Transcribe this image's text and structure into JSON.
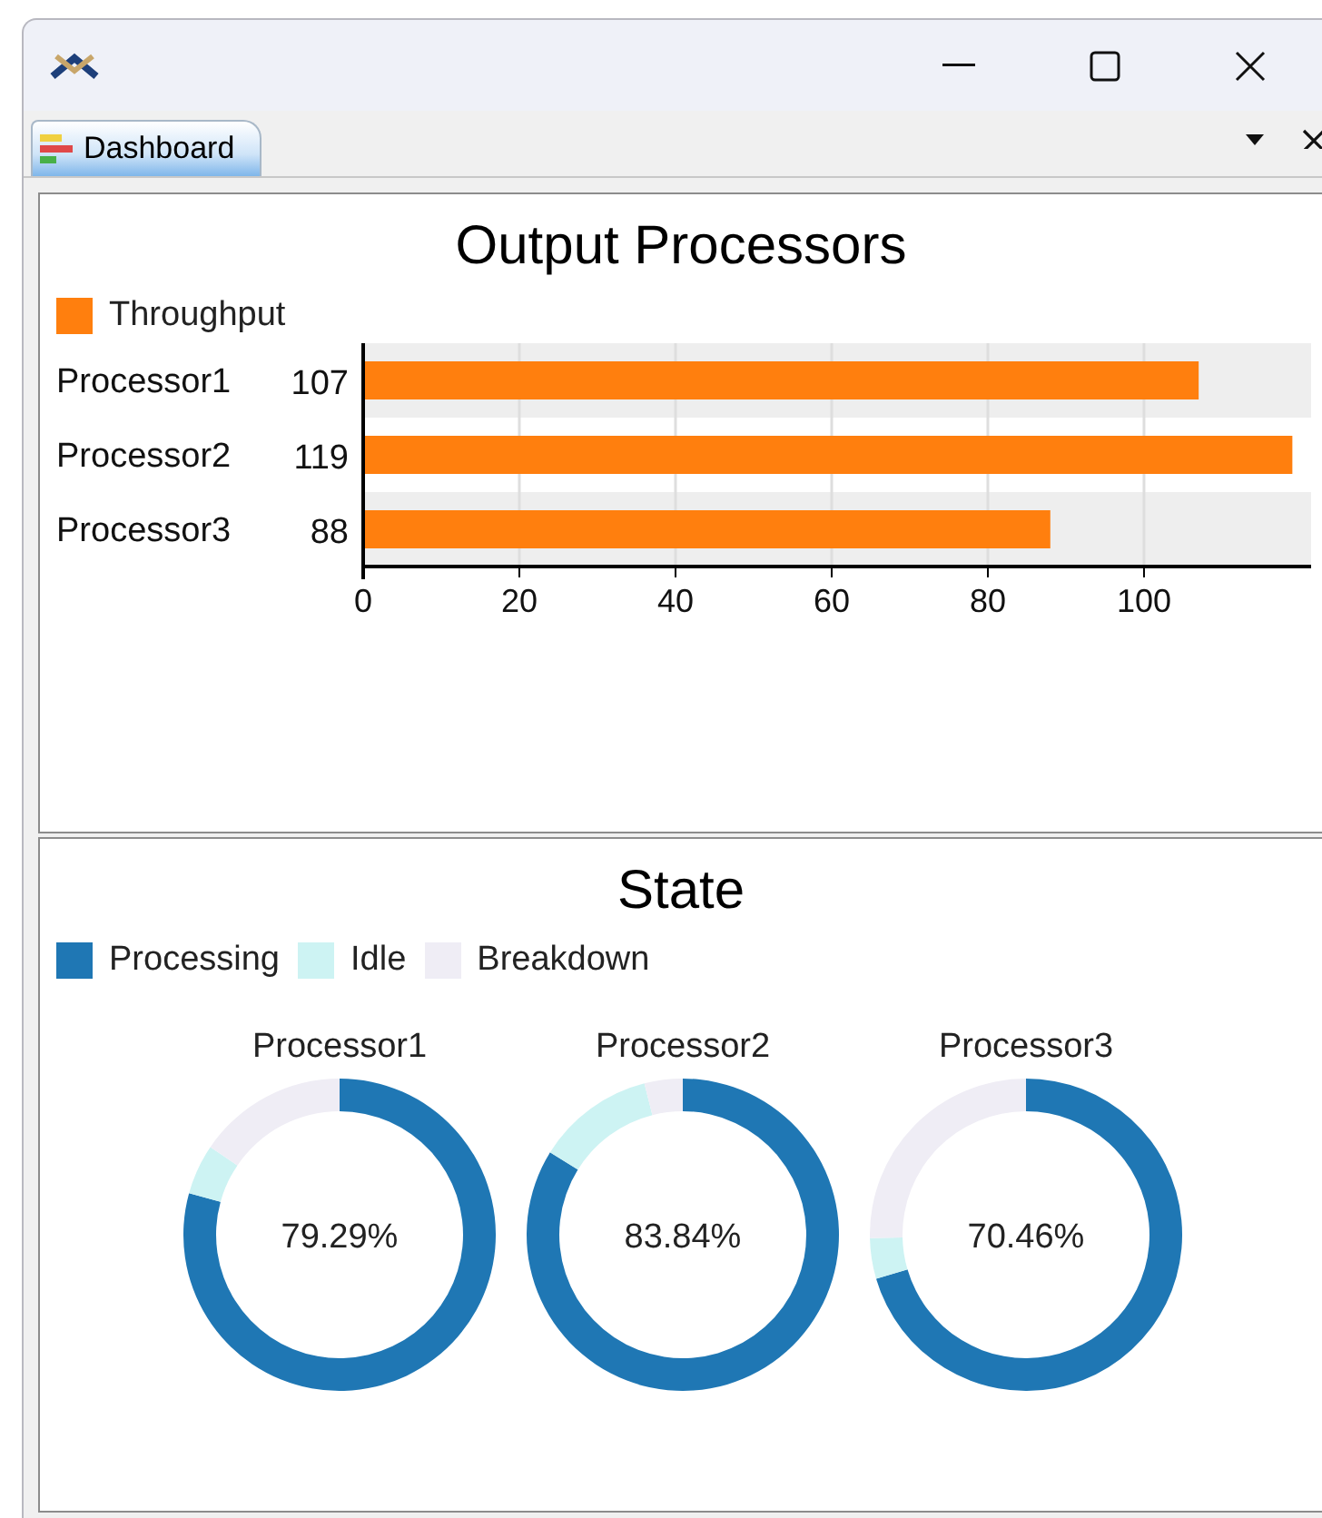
{
  "window": {
    "controls": [
      {
        "kind": "minimize"
      },
      {
        "kind": "maximize"
      },
      {
        "kind": "close"
      }
    ]
  },
  "tabs": [
    {
      "label": "Dashboard",
      "selected": true
    }
  ],
  "bar_panel": {
    "title": "Output Processors",
    "chart_data": {
      "type": "bar",
      "orientation": "horizontal",
      "categories": [
        "Processor1",
        "Processor2",
        "Processor3"
      ],
      "series": [
        {
          "name": "Throughput",
          "color": "#ff7f0e",
          "values": [
            107,
            119,
            88
          ]
        }
      ],
      "xlim": [
        0,
        121.4
      ],
      "grid": true,
      "xticks": [
        0,
        20,
        40,
        60,
        80,
        100
      ],
      "data_labels": true
    }
  },
  "state_panel": {
    "title": "State",
    "legend": [
      {
        "label": "Processing",
        "color": "#1f77b4"
      },
      {
        "label": "Idle",
        "color": "#cdf3f3"
      },
      {
        "label": "Breakdown",
        "color": "#efedf5"
      }
    ],
    "donuts": [
      {
        "title": "Processor1",
        "center": "79.29%",
        "chart_data": {
          "type": "donut",
          "values": [
            79.29,
            5.2,
            15.51
          ]
        }
      },
      {
        "title": "Processor2",
        "center": "83.84%",
        "chart_data": {
          "type": "donut",
          "values": [
            83.84,
            12.2,
            3.96
          ]
        }
      },
      {
        "title": "Processor3",
        "center": "70.46%",
        "chart_data": {
          "type": "donut",
          "values": [
            70.46,
            4.2,
            25.34
          ]
        }
      }
    ]
  }
}
